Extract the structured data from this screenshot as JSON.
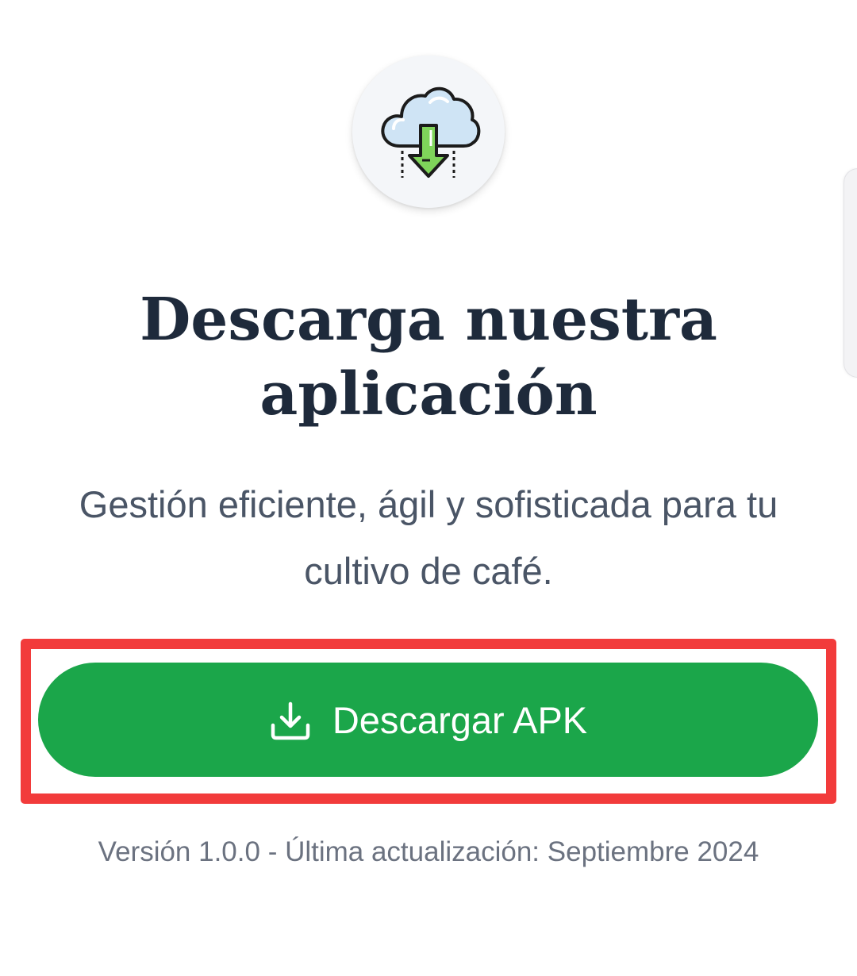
{
  "hero": {
    "icon": "cloud-download-icon",
    "title": "Descarga nuestra aplicación",
    "subtitle": "Gestión eficiente, ágil y sofisticada para tu cultivo de café."
  },
  "download": {
    "icon": "download-tray-icon",
    "label": "Descargar APK",
    "color": "#1ba64a"
  },
  "footer": {
    "version_text": "Versión 1.0.0 - Última actualización: Septiembre 2024"
  },
  "highlight_color": "#f23b3b"
}
